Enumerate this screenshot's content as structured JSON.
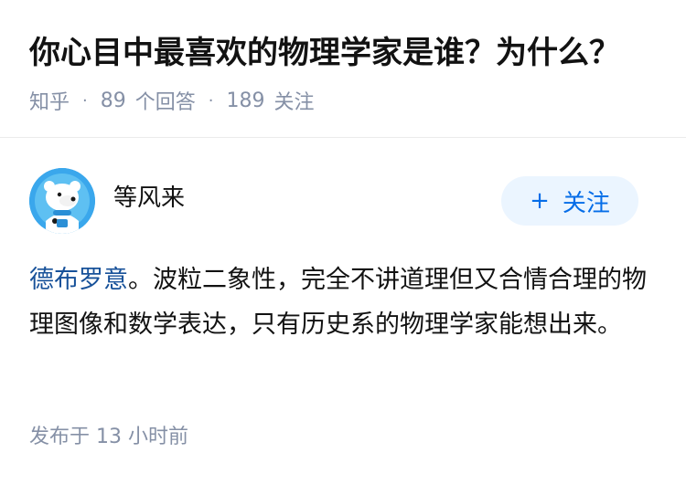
{
  "question": {
    "title": "你心目中最喜欢的物理学家是谁？为什么？",
    "site": "知乎",
    "separator": "·",
    "answer_count": "89",
    "answer_label": "个回答",
    "follower_count": "189",
    "follower_label": "关注"
  },
  "answer": {
    "author_name": "等风来",
    "avatar_icon": "polar-bear-avatar-icon",
    "follow_plus": "+",
    "follow_label": "关注",
    "link_text": "德布罗意",
    "body_text": "。波粒二象性，完全不讲道理但又合情合理的物理图像和数学表达，只有历史系的物理学家能想出来。",
    "published_prefix": "发布于",
    "published_time": "13 小时前"
  },
  "colors": {
    "title": "#121212",
    "meta": "#8590a6",
    "link": "#175199",
    "follow_bg": "#ebf5ff",
    "follow_text": "#056de8",
    "avatar_bg": "#3aa7ec"
  }
}
